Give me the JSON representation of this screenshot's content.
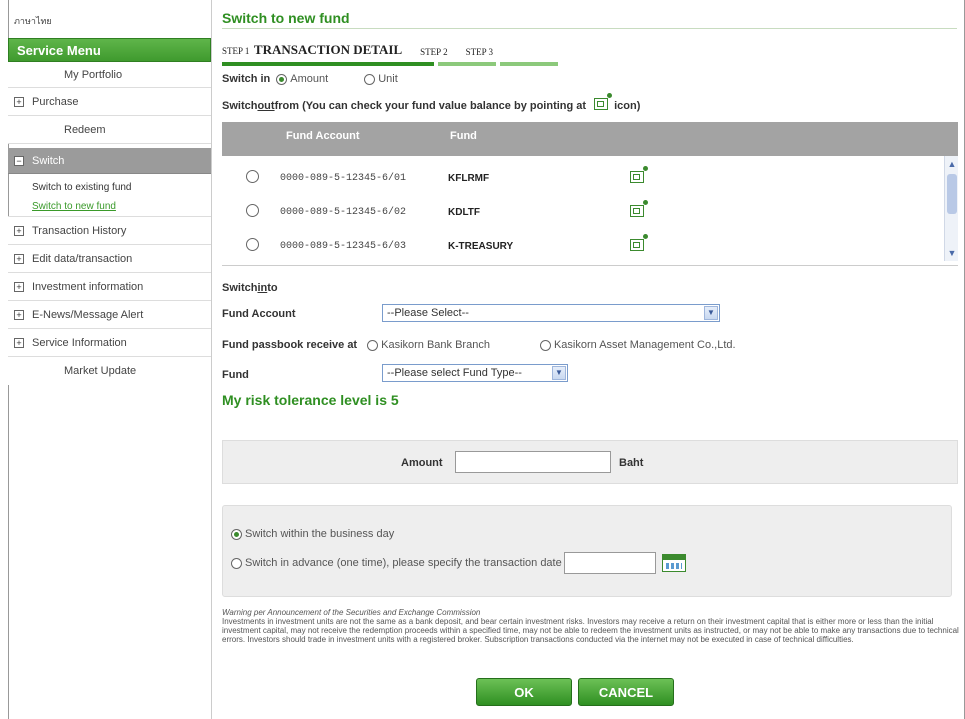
{
  "sidebar": {
    "top_text": "ภาษาไทย",
    "menu_title": "Service Menu",
    "items": [
      {
        "label": "My Portfolio",
        "type": "indent"
      },
      {
        "label": "Purchase",
        "type": "plus",
        "box": "+"
      },
      {
        "label": "Redeem",
        "type": "indent"
      },
      {
        "label": "Switch",
        "type": "active",
        "box": "−"
      },
      {
        "label": "Transaction History",
        "type": "plus",
        "box": "+"
      },
      {
        "label": "Edit data/transaction",
        "type": "plus",
        "box": "+"
      },
      {
        "label": "Investment information",
        "type": "plus",
        "box": "+"
      },
      {
        "label": "E-News/Message Alert",
        "type": "plus",
        "box": "+"
      },
      {
        "label": "Service Information",
        "type": "plus",
        "box": "+"
      },
      {
        "label": "Market Update",
        "type": "indent"
      }
    ],
    "sub_items": [
      "Switch to existing fund",
      "Switch to new fund"
    ]
  },
  "main": {
    "title": "Switch to new fund",
    "steps": {
      "step1_prefix": "STEP 1",
      "step1_label": "TRANSACTION DETAIL",
      "step2": "STEP 2",
      "step3": "STEP 3"
    },
    "switch_in": {
      "label": "Switch in",
      "opt_amount": "Amount",
      "opt_unit": "Unit"
    },
    "switch_out_text": {
      "prefix": "Switch ",
      "out": "out",
      "rest": " from (You can check your fund value balance by pointing at",
      "suffix": " icon)"
    },
    "table": {
      "col_account": "Fund Account",
      "col_fund": "Fund",
      "rows": [
        {
          "account": "0000-089-5-12345-6/01",
          "fund": "KFLRMF"
        },
        {
          "account": "0000-089-5-12345-6/02",
          "fund": "KDLTF"
        },
        {
          "account": "0000-089-5-12345-6/03",
          "fund": "K-TREASURY"
        }
      ]
    },
    "switch_into": {
      "prefix": "Switch ",
      "in": "in",
      "suffix": " to"
    },
    "fund_account_label": "Fund Account",
    "fund_account_select": "--Please Select--",
    "passbook_label": "Fund passbook receive at",
    "passbook_opt1": "Kasikorn Bank Branch",
    "passbook_opt2": "Kasikorn Asset Management Co.,Ltd.",
    "fund_label": "Fund",
    "fund_select": "--Please select Fund Type--",
    "risk_text": "My risk tolerance level is 5",
    "amount_label": "Amount",
    "amount_unit": "Baht",
    "opt_within": "Switch within the business day",
    "opt_advance": "Switch in advance (one time), please specify the transaction date",
    "warning_title": "Warning per Announcement of the Securities and Exchange Commission",
    "warning_body": "Investments in investment units are not the same as a bank deposit, and bear certain investment risks. Investors may receive a return on their investment capital that is either more or less than the initial investment capital, may not receive the redemption proceeds within a specified time, may not be able to redeem the investment units as instructed, or may not be able to make any transactions due to technical errors. Investors should trade in investment units with a registered broker. Subscription transactions conducted via the internet may not be executed in case of technical difficulties.",
    "ok_label": "OK",
    "cancel_label": "CANCEL"
  },
  "colors": {
    "accent": "#2f8f22",
    "menu_head": "#4fa83c",
    "table_head": "#a3a3a3"
  }
}
